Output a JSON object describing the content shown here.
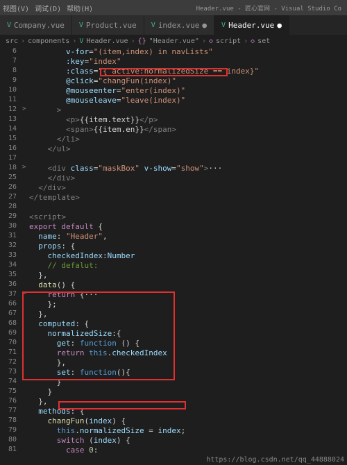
{
  "titlebar": {
    "menus": [
      "视图(V)",
      "调试(D)",
      "帮助(H)"
    ],
    "title": "Header.vue - 匠心官网 - Visual Studio Co"
  },
  "tabs": [
    {
      "label": "Company.vue",
      "active": false
    },
    {
      "label": "Product.vue",
      "active": false
    },
    {
      "label": "index.vue",
      "active": false,
      "dirty": true
    },
    {
      "label": "Header.vue",
      "active": true,
      "dirty": true
    }
  ],
  "breadcrumb": {
    "parts": [
      "src",
      "components",
      "Header.vue",
      "{}",
      "\"Header.vue\"",
      "script",
      "set"
    ]
  },
  "code": [
    {
      "n": 6,
      "t": "        <span class='attr'>v-for</span><span class='pn'>=</span><span class='str'>\"(item,index) in navLists\"</span>"
    },
    {
      "n": 7,
      "t": "        <span class='attr'>:key</span><span class='pn'>=</span><span class='str'>\"index\"</span>"
    },
    {
      "n": 8,
      "t": "        <span class='attr'>:class</span><span class='pn'>=</span><span class='str'>\"{ active:normalizedSize == index}\"</span>"
    },
    {
      "n": 9,
      "t": "        <span class='attr'>@click</span><span class='pn'>=</span><span class='str'>\"changFun(index)\"</span>"
    },
    {
      "n": 10,
      "t": "        <span class='attr'>@mouseenter</span><span class='pn'>=</span><span class='str'>\"enter(index)\"</span>"
    },
    {
      "n": 11,
      "t": "        <span class='attr'>@mouseleave</span><span class='pn'>=</span><span class='str'>\"leave(index)\"</span>"
    },
    {
      "n": 12,
      "f": ">",
      "t": "      <span class='tag'>&gt;</span>"
    },
    {
      "n": 13,
      "t": "        <span class='tag'>&lt;p&gt;</span>{{item.text}}<span class='tag'>&lt;/p&gt;</span>"
    },
    {
      "n": 14,
      "t": "        <span class='tag'>&lt;span&gt;</span>{{item.en}}<span class='tag'>&lt;/span&gt;</span>"
    },
    {
      "n": 15,
      "t": "      <span class='tag'>&lt;/li&gt;</span>"
    },
    {
      "n": 16,
      "t": "    <span class='tag'>&lt;/ul&gt;</span>"
    },
    {
      "n": 17,
      "t": ""
    },
    {
      "n": 18,
      "f": ">",
      "t": "    <span class='tag'>&lt;div</span> <span class='attr'>class</span><span class='pn'>=</span><span class='str'>\"maskBox\"</span> <span class='attr'>v-show</span><span class='pn'>=</span><span class='str'>\"show\"</span><span class='tag'>&gt;</span><span class='pn'>···</span>"
    },
    {
      "n": 25,
      "t": "    <span class='tag'>&lt;/div&gt;</span>"
    },
    {
      "n": 26,
      "t": "  <span class='tag'>&lt;/div&gt;</span>"
    },
    {
      "n": 27,
      "t": "<span class='tag'>&lt;/template&gt;</span>"
    },
    {
      "n": 28,
      "t": ""
    },
    {
      "n": 29,
      "t": "<span class='tag'>&lt;script&gt;</span>"
    },
    {
      "n": 30,
      "t": "<span class='kw2'>export</span> <span class='kw2'>default</span> <span class='pn'>{</span>"
    },
    {
      "n": 31,
      "t": "  <span class='var'>name</span><span class='pn'>:</span> <span class='str'>\"Header\"</span><span class='pn'>,</span>"
    },
    {
      "n": 32,
      "t": "  <span class='var'>props</span><span class='pn'>: {</span>"
    },
    {
      "n": 33,
      "t": "    <span class='var'>checkedIndex</span><span class='pn'>:</span><span class='var'>Number</span>"
    },
    {
      "n": 34,
      "t": "    <span class='cmt'>// defalut:</span>"
    },
    {
      "n": 35,
      "t": "  <span class='pn'>},</span>"
    },
    {
      "n": 36,
      "t": "  <span class='fn'>data</span><span class='pn'>() {</span>"
    },
    {
      "n": 37,
      "f": ">",
      "t": "    <span class='kw2'>return</span> <span class='pn'>{</span><span class='pn'>···</span>"
    },
    {
      "n": 66,
      "t": "    <span class='pn'>};</span>"
    },
    {
      "n": 67,
      "t": "  <span class='pn'>},</span>"
    },
    {
      "n": 68,
      "t": "  <span class='var'>computed</span><span class='pn'>: {</span>"
    },
    {
      "n": 69,
      "t": "    <span class='var'>normalizedSize</span><span class='pn'>:{</span>"
    },
    {
      "n": 70,
      "t": "      <span class='var'>get</span><span class='pn'>:</span> <span class='kw'>function</span> <span class='pn'>() {</span>"
    },
    {
      "n": 71,
      "t": "      <span class='kw2'>return</span> <span class='this'>this</span><span class='pn'>.</span><span class='var'>checkedIndex</span>"
    },
    {
      "n": 72,
      "t": "      <span class='pn'>},</span>"
    },
    {
      "n": 73,
      "t": "      <span class='var'>set</span><span class='pn'>:</span> <span class='kw'>function</span><span class='pn'>(){</span>"
    },
    {
      "n": 74,
      "t": "      <span class='pn'>}</span>"
    },
    {
      "n": 75,
      "t": "    <span class='pn'>}</span>"
    },
    {
      "n": 76,
      "t": "  <span class='pn'>},</span>"
    },
    {
      "n": 77,
      "t": "  <span class='var'>methods</span><span class='pn'>: {</span>"
    },
    {
      "n": 78,
      "t": "    <span class='fn'>changFun</span><span class='pn'>(</span><span class='var'>index</span><span class='pn'>) {</span>"
    },
    {
      "n": 79,
      "t": "      <span class='this'>this</span><span class='pn'>.</span><span class='var'>normalizedSize</span> <span class='pn'>=</span> <span class='var'>index</span><span class='pn'>;</span>"
    },
    {
      "n": 80,
      "t": "      <span class='kw2'>switch</span> <span class='pn'>(</span><span class='var'>index</span><span class='pn'>) {</span>"
    },
    {
      "n": 81,
      "t": "        <span class='kw2'>case</span> <span class='num'>0</span><span class='pn'>:</span>"
    }
  ],
  "watermark": "https://blog.csdn.net/qq_44888024"
}
